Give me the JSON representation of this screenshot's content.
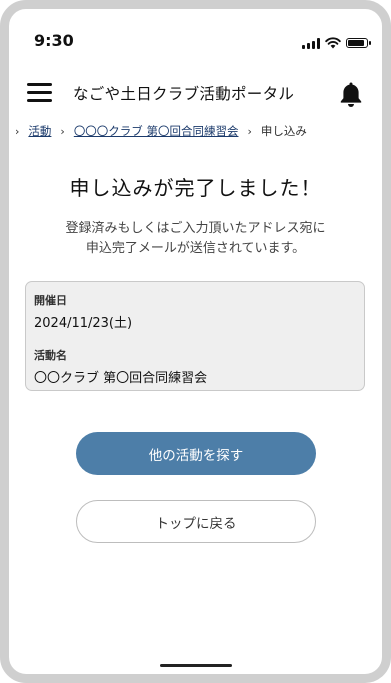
{
  "status_bar": {
    "time": "9:30"
  },
  "header": {
    "title": "なごや土日クラブ活動ポータル"
  },
  "breadcrumb": {
    "items": [
      {
        "label": "活動",
        "link": true
      },
      {
        "label": "〇〇〇クラブ 第〇回合同練習会",
        "link": true
      },
      {
        "label": "申し込み",
        "link": false
      }
    ]
  },
  "main": {
    "heading": "申し込みが完了しました！",
    "message_lines": [
      "登録済みもしくはご入力頂いたアドレス宛に",
      "申込完了メールが送信されています。"
    ]
  },
  "details": {
    "date_label": "開催日",
    "date_value": "2024/11/23(土)",
    "activity_label": "活動名",
    "activity_value": "〇〇クラブ 第〇回合同練習会"
  },
  "buttons": {
    "find_other": "他の活動を探す",
    "back_top": "トップに戻る"
  },
  "colors": {
    "primary_button": "#4d7ea8",
    "link": "#1b3a6b",
    "card_background": "#efefef",
    "device_frame": "#cfcfcf"
  },
  "icons": {
    "menu": "hamburger-menu-icon",
    "notifications": "bell-icon",
    "signal": "signal-icon",
    "wifi": "wifi-icon",
    "battery": "battery-icon"
  }
}
